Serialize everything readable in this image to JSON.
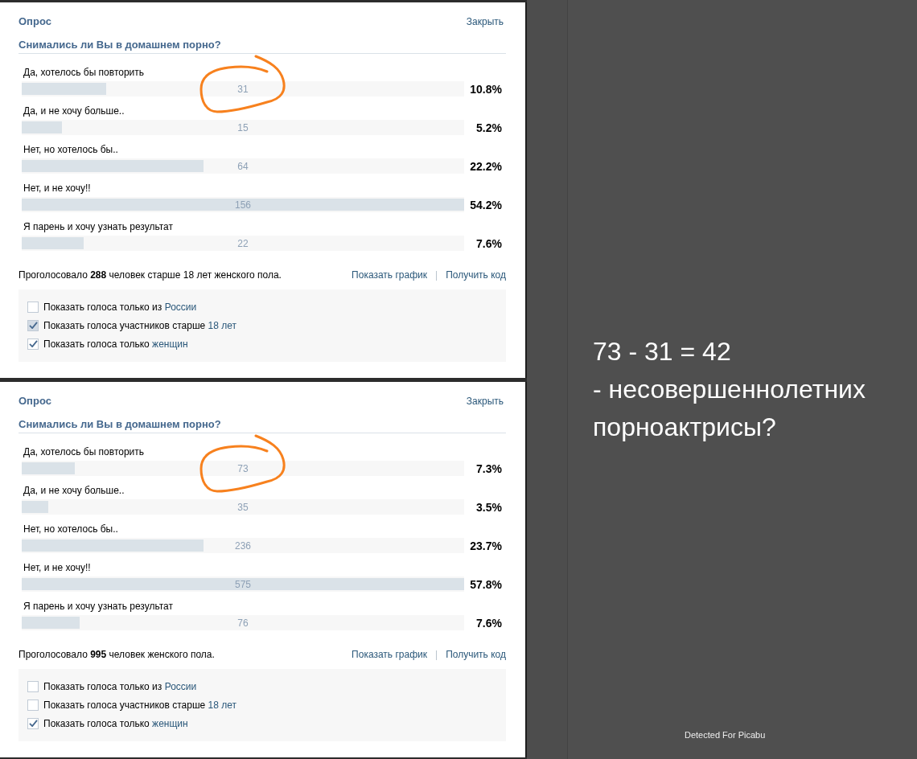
{
  "polls": [
    {
      "title": "Опрос",
      "close": "Закрыть",
      "question": "Снимались ли Вы в домашнем порно?",
      "options": [
        {
          "label": "Да, хотелось бы повторить",
          "count": "31",
          "percent": "10.8%",
          "level": 0.19,
          "circled": true
        },
        {
          "label": "Да, и не хочу больше..",
          "count": "15",
          "percent": "5.2%",
          "level": 0.09,
          "circled": false
        },
        {
          "label": "Нет, но хотелось бы..",
          "count": "64",
          "percent": "22.2%",
          "level": 0.41,
          "circled": false
        },
        {
          "label": "Нет, и не хочу!!",
          "count": "156",
          "percent": "54.2%",
          "level": 1,
          "circled": false
        },
        {
          "label": "Я парень и хочу узнать результат",
          "count": "22",
          "percent": "7.6%",
          "level": 0.14,
          "circled": false
        }
      ],
      "summary": "Проголосовало **288** человек старше 18 лет женского пола.",
      "links": [
        "Показать график",
        "Получить код"
      ],
      "separator": "|",
      "filters": [
        {
          "text": "Показать голоса только из",
          "link": "России",
          "checked": false,
          "hovered": false
        },
        {
          "text": "Показать голоса участников старше",
          "link": "18 лет",
          "checked": true,
          "hovered": true
        },
        {
          "text": "Показать голоса только",
          "link": "женщин",
          "checked": true,
          "hovered": false
        }
      ]
    },
    {
      "title": "Опрос",
      "close": "Закрыть",
      "question": "Снимались ли Вы в домашнем порно?",
      "options": [
        {
          "label": "Да, хотелось бы повторить",
          "count": "73",
          "percent": "7.3%",
          "level": 0.12,
          "circled": true
        },
        {
          "label": "Да, и не хочу больше..",
          "count": "35",
          "percent": "3.5%",
          "level": 0.06,
          "circled": false
        },
        {
          "label": "Нет, но хотелось бы..",
          "count": "236",
          "percent": "23.7%",
          "level": 0.41,
          "circled": false
        },
        {
          "label": "Нет, и не хочу!!",
          "count": "575",
          "percent": "57.8%",
          "level": 1,
          "circled": false
        },
        {
          "label": "Я парень и хочу узнать результат",
          "count": "76",
          "percent": "7.6%",
          "level": 0.13,
          "circled": false
        }
      ],
      "summary": "Проголосовало **995** человек женского пола.",
      "links": [
        "Показать график",
        "Получить код"
      ],
      "separator": "|",
      "filters": [
        {
          "text": "Показать голоса только из",
          "link": "России",
          "checked": false,
          "hovered": false
        },
        {
          "text": "Показать голоса участников старше",
          "link": "18 лет",
          "checked": false,
          "hovered": false
        },
        {
          "text": "Показать голоса только",
          "link": "женщин",
          "checked": true,
          "hovered": false
        }
      ]
    }
  ],
  "caption": [
    "73 - 31 = 42",
    "- несовершеннолетних",
    "порноактрисы?"
  ],
  "note": "Detected For Picabu"
}
